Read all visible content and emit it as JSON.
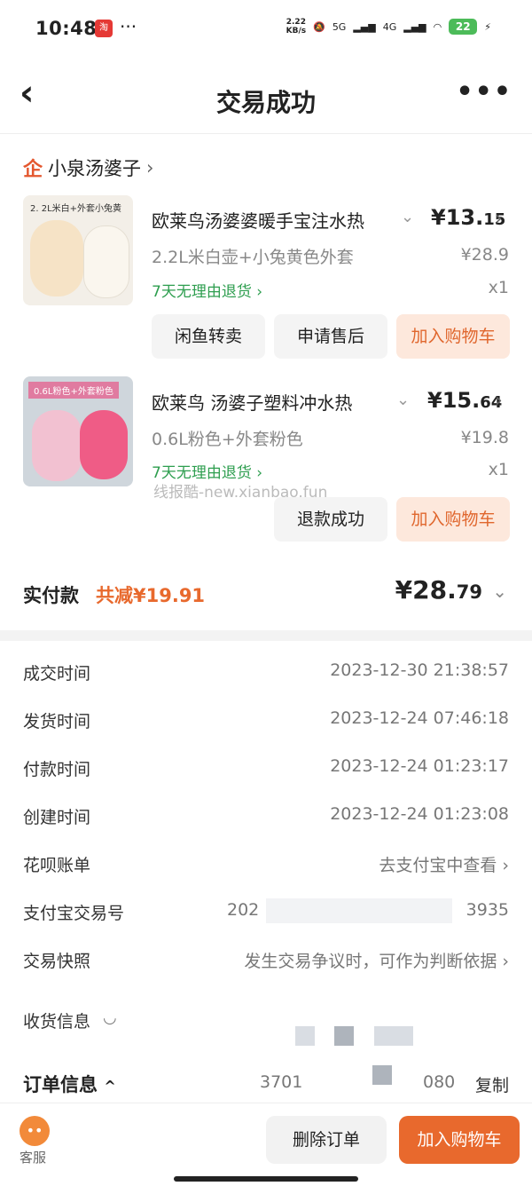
{
  "status": {
    "time": "10:48",
    "speed": "2.22\nKB/s",
    "net1": "5G",
    "net2": "4G",
    "battery": "22"
  },
  "header": {
    "title": "交易成功",
    "back": "‹",
    "more": "•••"
  },
  "store": {
    "icon": "企",
    "name": "小泉汤婆子",
    "chevron": "›"
  },
  "items": [
    {
      "thumb_text": "2. 2L米白+外套小兔黄",
      "name": "欧莱鸟汤婆婆暖手宝注水热",
      "price_main": "¥13.",
      "price_dec": "15",
      "spec": "2.2L米白壶+小兔黄色外套",
      "orig": "¥28.9",
      "return": "7天无理由退货 ›",
      "qty": "x1",
      "buttons": [
        "闲鱼转卖",
        "申请售后",
        "加入购物车"
      ]
    },
    {
      "thumb_text": "0.6L粉色+外套粉色",
      "name": "欧莱鸟 汤婆子塑料冲水热",
      "price_main": "¥15.",
      "price_dec": "64",
      "spec": "0.6L粉色+外套粉色",
      "orig": "¥19.8",
      "return": "7天无理由退货 ›",
      "qty": "x1",
      "buttons": [
        "退款成功",
        "加入购物车"
      ]
    }
  ],
  "watermark": "线报酷-new.xianbao.fun",
  "payment": {
    "label": "实付款",
    "discount": "共减¥19.91",
    "total_main": "¥28.",
    "total_dec": "79"
  },
  "details": [
    {
      "label": "成交时间",
      "value": "2023-12-30 21:38:57"
    },
    {
      "label": "发货时间",
      "value": "2023-12-24 07:46:18"
    },
    {
      "label": "付款时间",
      "value": "2023-12-24 01:23:17"
    },
    {
      "label": "创建时间",
      "value": "2023-12-24 01:23:08"
    },
    {
      "label": "花呗账单",
      "value": "去支付宝中查看 ›"
    },
    {
      "label": "支付宝交易号",
      "value_left": "202",
      "value_right": "3935"
    },
    {
      "label": "交易快照",
      "value": "发生交易争议时，可作为判断依据 ›"
    },
    {
      "label": "收货信息",
      "value": ""
    }
  ],
  "order": {
    "label": "订单信息",
    "num_left": "3701",
    "num_right": "080",
    "copy": "复制"
  },
  "bottom": {
    "service": "客服",
    "delete": "删除订单",
    "add_cart": "加入购物车"
  },
  "colors": {
    "accent": "#e8692d",
    "green": "#2e9e4f"
  }
}
